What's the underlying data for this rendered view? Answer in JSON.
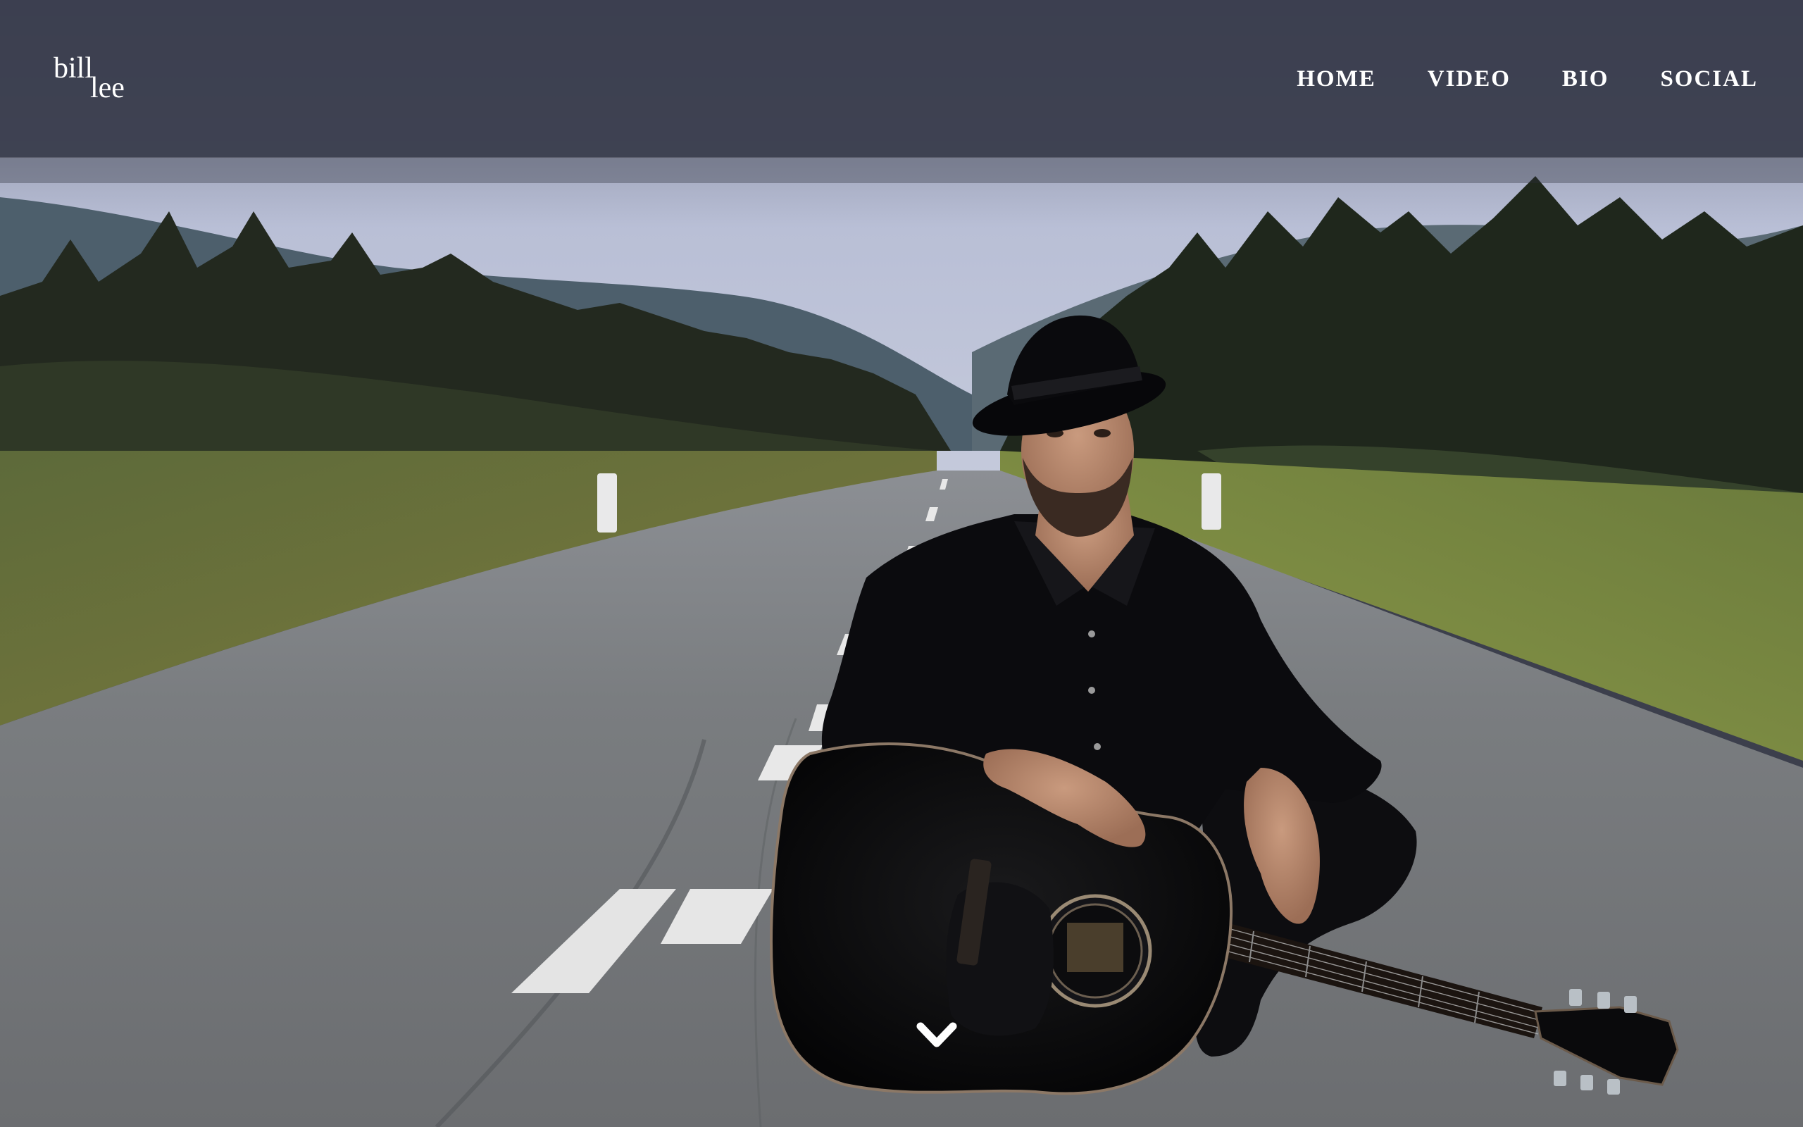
{
  "brand": {
    "logo_first": "bill",
    "logo_last": "lee"
  },
  "nav": {
    "items": [
      {
        "label": "HOME"
      },
      {
        "label": "VIDEO"
      },
      {
        "label": "BIO"
      },
      {
        "label": "SOCIAL"
      }
    ]
  },
  "hero": {
    "scroll_icon": "chevron-down-icon"
  },
  "colors": {
    "header_bg": "#3a3d4e",
    "nav_text": "#ffffff",
    "accent_white": "#ffffff"
  }
}
